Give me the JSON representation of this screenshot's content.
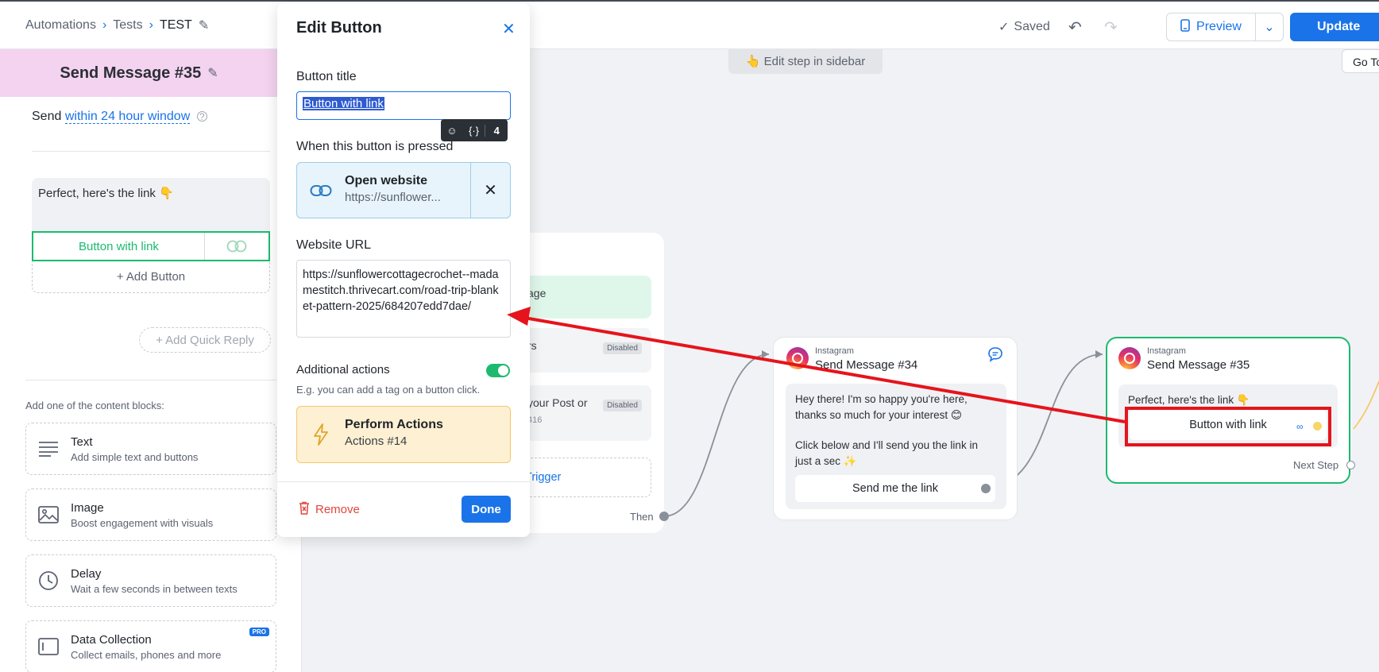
{
  "breadcrumb": {
    "items": [
      "Automations",
      "Tests",
      "TEST"
    ]
  },
  "toolbar": {
    "saved": "Saved",
    "preview": "Preview",
    "update": "Update"
  },
  "left_panel": {
    "step_title": "Send Message #35",
    "send_prefix": "Send",
    "send_window": "within 24 hour window",
    "message_text": "Perfect, here's the link 👇",
    "button_label": "Button with link",
    "add_button": "+ Add Button",
    "add_quick_reply": "+ Add Quick Reply",
    "blocks_title": "Add one of the content blocks:",
    "blocks": [
      {
        "title": "Text",
        "desc": "Add simple text and buttons"
      },
      {
        "title": "Image",
        "desc": "Boost engagement with visuals"
      },
      {
        "title": "Delay",
        "desc": "Wait a few seconds in between texts"
      },
      {
        "title": "Data Collection",
        "desc": "Collect emails, phones and more",
        "badge": "PRO"
      }
    ]
  },
  "modal": {
    "title": "Edit Button",
    "button_title_label": "Button title",
    "button_title_value": "Button with link",
    "char_count": "4",
    "pressed_label": "When this button is pressed",
    "action_title": "Open website",
    "action_sub": "https://sunflower...",
    "url_label": "Website URL",
    "url_value": "https://sunflowercottagecrochet--madamestitch.thrivecart.com/road-trip-blanket-pattern-2025/684207edd7dae/",
    "additional_label": "Additional actions",
    "additional_desc": "E.g. you can add a tag on a button click.",
    "perform_title": "Perform Actions",
    "perform_sub": "Actions #14",
    "remove": "Remove",
    "done": "Done"
  },
  "canvas": {
    "edit_pill": "👆 Edit step in sidebar",
    "goto": "Go To",
    "trigger_items": [
      {
        "text": "age"
      },
      {
        "text": "rs",
        "badge": "Disabled"
      },
      {
        "text": "your Post or",
        "sub": "416",
        "badge": "Disabled"
      }
    ],
    "trigger_link": "Trigger",
    "then": "Then",
    "card34": {
      "platform": "Instagram",
      "title": "Send Message #34",
      "message_l1": "Hey there! I'm so happy you're here,",
      "message_l2": "thanks so much for your interest 😊",
      "message_l3": "Click below and I'll send you the link in",
      "message_l4": "just a sec ✨",
      "button": "Send me the link"
    },
    "card35": {
      "platform": "Instagram",
      "title": "Send Message #35",
      "message": "Perfect, here's the link 👇",
      "button": "Button with link",
      "next_step": "Next Step"
    }
  },
  "colors": {
    "accent": "#1a73e8",
    "success": "#1cba6f",
    "annotation": "#e5141c",
    "step_header": "#f3d3ef"
  }
}
